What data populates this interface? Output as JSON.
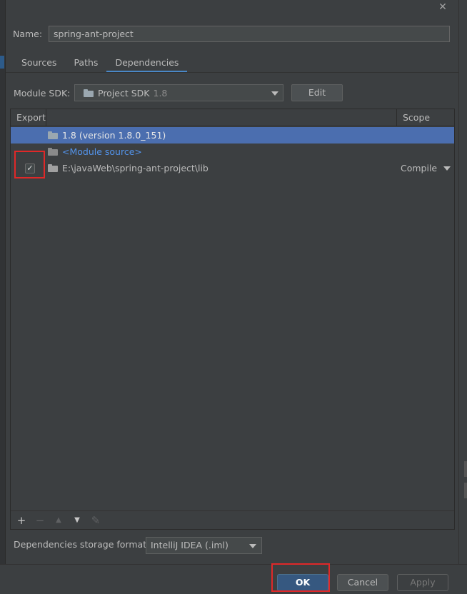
{
  "name": {
    "label": "Name:",
    "value": "spring-ant-project"
  },
  "tabs": [
    {
      "label": "Sources"
    },
    {
      "label": "Paths"
    },
    {
      "label": "Dependencies",
      "active": true
    }
  ],
  "module_sdk": {
    "label": "Module SDK:",
    "value": "Project SDK",
    "version": "1.8",
    "edit_label": "Edit"
  },
  "table": {
    "headers": {
      "export": "Export",
      "scope": "Scope"
    },
    "rows": [
      {
        "name": "1.8 (version 1.8.0_151)",
        "selected": true,
        "icon": "jdk-folder-icon"
      },
      {
        "name": "<Module source>",
        "icon": "module-source-folder-icon"
      },
      {
        "name": "E:\\javaWeb\\spring-ant-project\\lib",
        "icon": "library-folder-icon",
        "exported": true,
        "scope": "Compile"
      }
    ],
    "checkmark": "✓",
    "toolbar": {
      "add": "+",
      "remove": "−",
      "up": "▲",
      "down": "▼",
      "edit": "✎"
    }
  },
  "storage_format": {
    "label": "Dependencies storage format:",
    "value": "IntelliJ IDEA (.iml)"
  },
  "buttons": {
    "ok": "OK",
    "cancel": "Cancel",
    "apply": "Apply"
  },
  "close_glyph": "✕",
  "colors": {
    "background": "#3c3f41",
    "selection": "#4b6eaf",
    "accent": "#4a88c7",
    "link": "#5394ec",
    "highlight": "#e02828"
  }
}
